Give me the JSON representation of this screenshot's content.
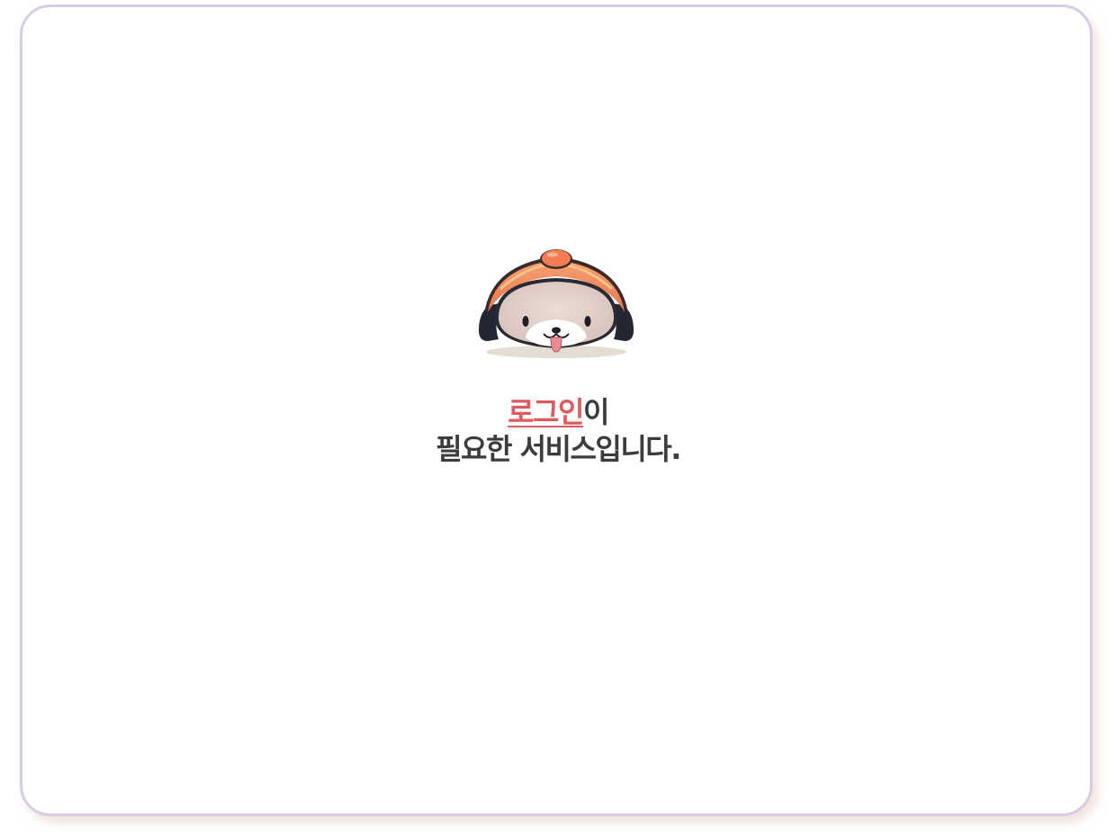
{
  "notice": {
    "login_link": "로그인",
    "line1_suffix": "이",
    "line2": "필요한 서비스입니다."
  },
  "colors": {
    "accent": "#e05a5f",
    "text": "#3d3b3c",
    "card_border": "#d8cbe3"
  },
  "mascot": {
    "icon": "dog-mascot-icon"
  }
}
